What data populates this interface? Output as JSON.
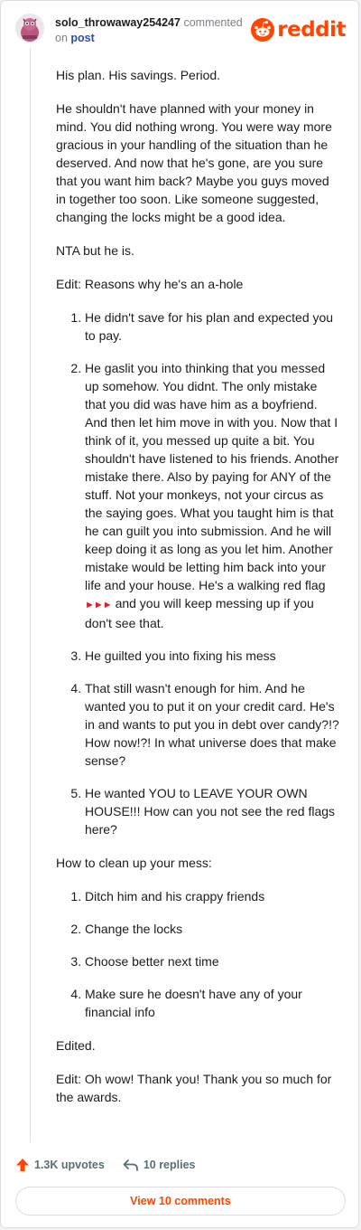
{
  "header": {
    "username": "solo_throwaway254247",
    "action_text": "commented",
    "on_text": "on",
    "post_link": "post",
    "logo_text": "reddit"
  },
  "comment": {
    "paragraphs_top": [
      "His plan. His savings. Period.",
      "He shouldn't have planned with your money in mind. You did nothing wrong. You were way more gracious in your handling of the situation than he deserved. And now that he's gone, are you sure that you want him back? Maybe you guys moved in together too soon. Like someone suggested, changing the locks might be a good idea.",
      "NTA but he is.",
      "Edit: Reasons why he's an a-hole"
    ],
    "reasons": [
      "He didn't save for his plan and expected you to pay.",
      "He gaslit you into thinking that you messed up somehow. You didnt. The only mistake that you did was have him as a boyfriend. And then let him move in with you. Now that I think of it, you messed up quite a bit. You shouldn't have listened to his friends. Another mistake there. Also by paying for ANY of the stuff. Not your monkeys, not your circus as the saying goes. What you taught him is that he can guilt you into submission. And he will keep doing it as long as you let him. Another mistake would be letting him back into your life and your house. He's a walking red flag",
      "He guilted you into fixing his mess",
      "That still wasn't enough for him. And he wanted you to put it on your credit card. He's in and wants to put you in debt over candy?!? How now!?! In what universe does that make sense?",
      "He wanted YOU to LEAVE YOUR OWN HOUSE!!! How can you not see the red flags here?"
    ],
    "reason2_flags": "►►►",
    "reason2_tail": "and you will keep messing up if you don't see that.",
    "cleanup_heading": "How to clean up your mess:",
    "cleanup_steps": [
      "Ditch him and his crappy friends",
      "Change the locks",
      "Choose better next time",
      "Make sure he doesn't have any of your financial info"
    ],
    "edited": "Edited.",
    "final_edit": "Edit: Oh wow! Thank you! Thank you so much for the awards."
  },
  "footer": {
    "upvotes": "1.3K upvotes",
    "replies": "10 replies",
    "view_comments": "View 10 comments"
  },
  "icons": {
    "upvote": "upvote-arrow-icon",
    "reply": "reply-arrow-icon",
    "logo": "reddit-alien-icon"
  },
  "colors": {
    "brand": "#ff4500",
    "link": "#2a4fa8",
    "flag": "#e31b2c",
    "muted": "#576f76"
  }
}
